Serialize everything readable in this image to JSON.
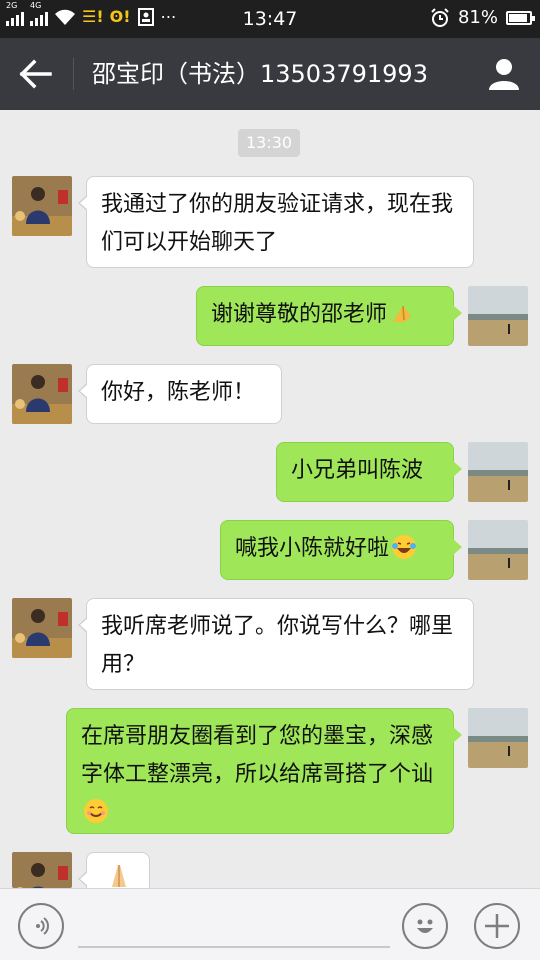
{
  "status_bar": {
    "network_labels": [
      "2G",
      "4G"
    ],
    "time": "13:47",
    "battery": "81%",
    "battery_level": 0.81
  },
  "header": {
    "title": "邵宝印（书法）13503791993"
  },
  "chat": {
    "timestamp": "13:30",
    "messages": [
      {
        "side": "in",
        "text": "我通过了你的朋友验证请求，现在我们可以开始聊天了"
      },
      {
        "side": "out",
        "text": "谢谢尊敬的邵老师",
        "emoji": "folded-hands"
      },
      {
        "side": "in",
        "text": "你好，陈老师！"
      },
      {
        "side": "out",
        "text": "小兄弟叫陈波"
      },
      {
        "side": "out",
        "text": "喊我小陈就好啦",
        "emoji": "laughing-tears"
      },
      {
        "side": "in",
        "text": "我听席老师说了。你说写什么？哪里用？"
      },
      {
        "side": "out",
        "text": "在席哥朋友圈看到了您的墨宝，深感字体工整漂亮，所以给席哥搭了个讪",
        "emoji": "smiling-face"
      },
      {
        "side": "in",
        "text": "",
        "emoji": "folded-hands"
      }
    ]
  },
  "colors": {
    "header_bg": "#393a3f",
    "outgoing_bubble": "#9fe658",
    "incoming_bubble": "#ffffff",
    "chat_bg": "#ebebeb"
  }
}
